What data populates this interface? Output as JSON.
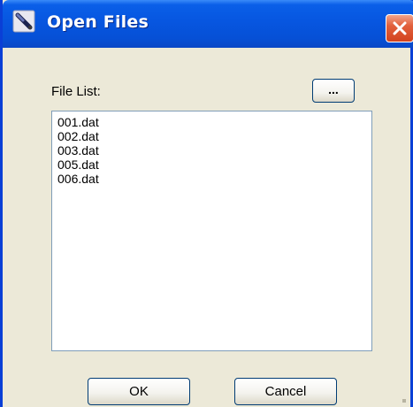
{
  "window": {
    "title": "Open Files",
    "title_icon": "pen-tool-icon",
    "close_icon": "close-icon"
  },
  "label": {
    "file_list": "File List:"
  },
  "browse_button": {
    "label": "..."
  },
  "files": [
    "001.dat",
    "002.dat",
    "003.dat",
    "005.dat",
    "006.dat"
  ],
  "buttons": {
    "ok": "OK",
    "cancel": "Cancel"
  },
  "colors": {
    "titlebar": "#0650d6",
    "dialog_background": "#ece9d8",
    "close_button": "#d2431e",
    "list_border": "#7f9db9"
  }
}
